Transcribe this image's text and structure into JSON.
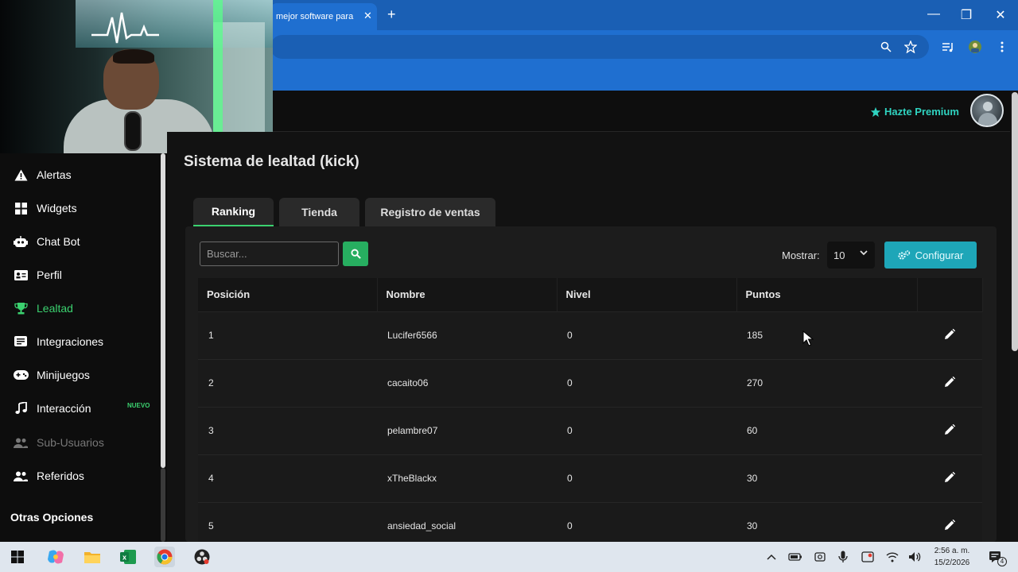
{
  "browser": {
    "tab_title": "mejor software para",
    "tab_close": "✕",
    "new_tab": "+",
    "min": "—",
    "restore": "❐",
    "close": "✕"
  },
  "header": {
    "premium_label": "Hazte Premium",
    "accent": "#2fd3c0"
  },
  "sidebar": {
    "items": [
      {
        "label": "Alertas",
        "icon": "warning-icon",
        "active": false,
        "dim": false
      },
      {
        "label": "Widgets",
        "icon": "grid-icon",
        "active": false,
        "dim": false
      },
      {
        "label": "Chat Bot",
        "icon": "robot-icon",
        "active": false,
        "dim": false
      },
      {
        "label": "Perfil",
        "icon": "id-card-icon",
        "active": false,
        "dim": false
      },
      {
        "label": "Lealtad",
        "icon": "trophy-icon",
        "active": true,
        "dim": false
      },
      {
        "label": "Integraciones",
        "icon": "integration-icon",
        "active": false,
        "dim": false
      },
      {
        "label": "Minijuegos",
        "icon": "gamepad-icon",
        "active": false,
        "dim": false
      },
      {
        "label": "Interacción",
        "icon": "music-icon",
        "active": false,
        "dim": false,
        "badge": "NUEVO"
      },
      {
        "label": "Sub-Usuarios",
        "icon": "users-icon",
        "active": false,
        "dim": true
      },
      {
        "label": "Referidos",
        "icon": "users-icon",
        "active": false,
        "dim": false
      }
    ],
    "section_label": "Otras Opciones",
    "active_color": "#3bd16f"
  },
  "main": {
    "title": "Sistema de lealtad (kick)",
    "tabs": [
      {
        "label": "Ranking",
        "active": true
      },
      {
        "label": "Tienda",
        "active": false
      },
      {
        "label": "Registro de ventas",
        "active": false
      }
    ],
    "search_placeholder": "Buscar...",
    "show_label": "Mostrar:",
    "show_value": "10",
    "config_label": "Configurar",
    "config_color": "#1ea6b8",
    "search_btn_color": "#27ae60"
  },
  "table": {
    "columns": [
      "Posición",
      "Nombre",
      "Nivel",
      "Puntos",
      ""
    ],
    "rows": [
      {
        "pos": "1",
        "name": "Lucifer6566",
        "level": "0",
        "points": "185"
      },
      {
        "pos": "2",
        "name": "cacaito06",
        "level": "0",
        "points": "270"
      },
      {
        "pos": "3",
        "name": "pelambre07",
        "level": "0",
        "points": "60"
      },
      {
        "pos": "4",
        "name": "xTheBlackx",
        "level": "0",
        "points": "30"
      },
      {
        "pos": "5",
        "name": "ansiedad_social",
        "level": "0",
        "points": "30"
      }
    ]
  },
  "taskbar": {
    "time": "2:56 a. m.",
    "date": "15/2/2026",
    "notif_count": "4"
  }
}
